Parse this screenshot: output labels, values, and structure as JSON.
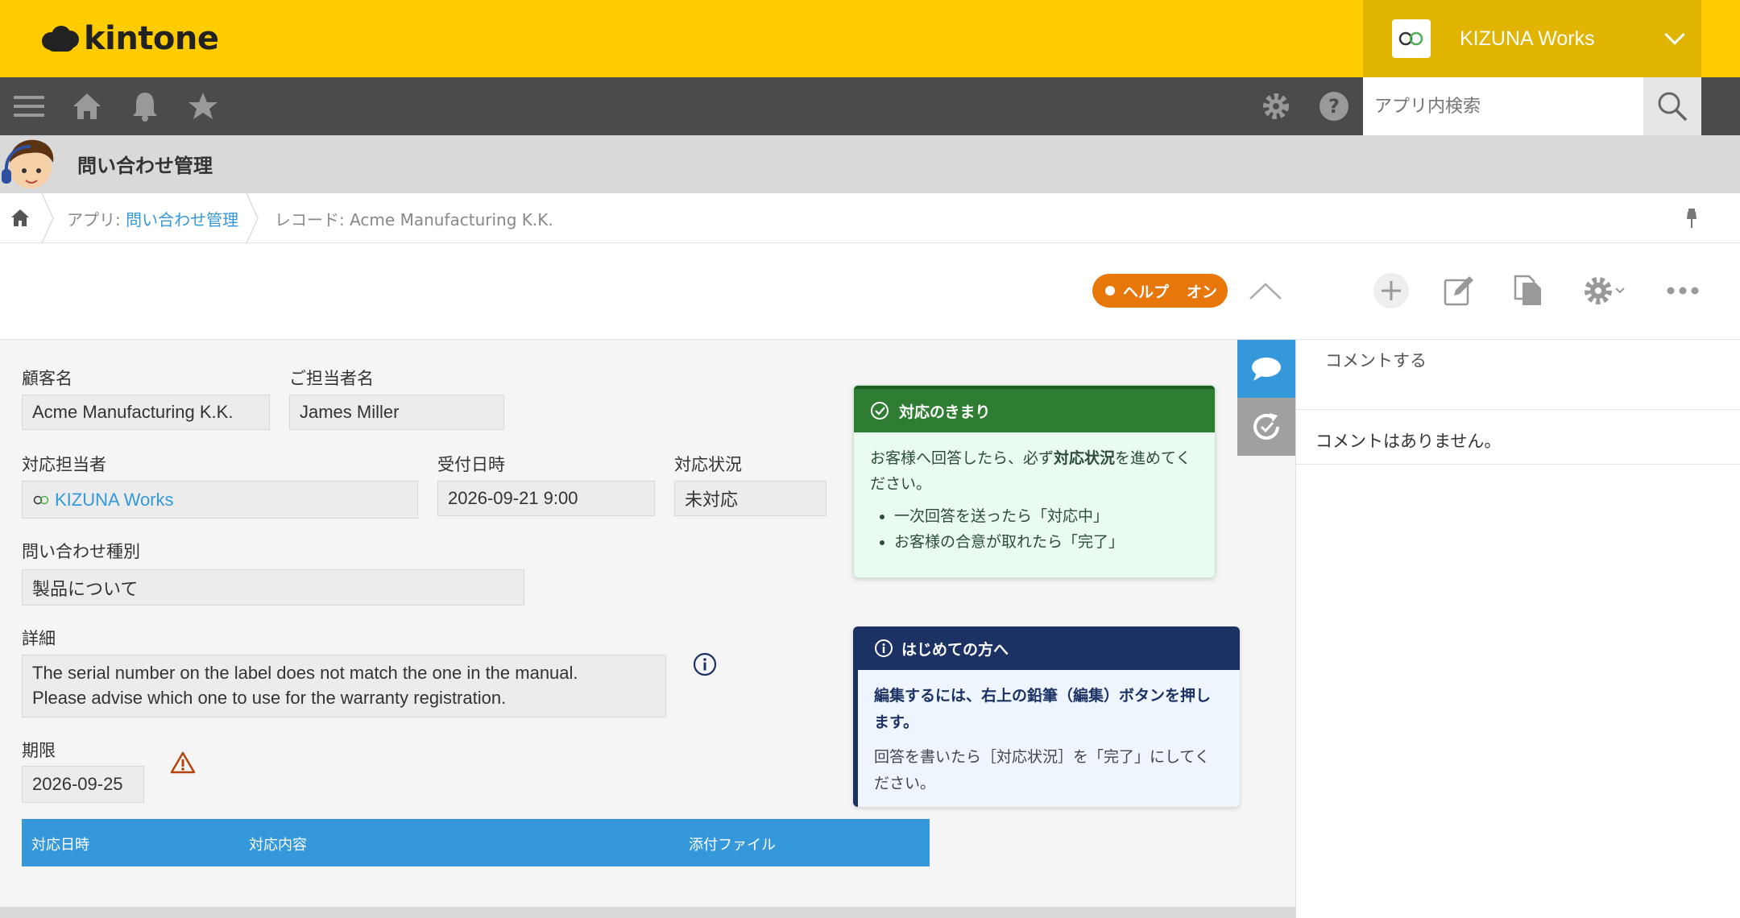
{
  "header": {
    "logo_text": "kintone",
    "org_name": "KIZUNA Works",
    "search_placeholder": "アプリ内検索"
  },
  "app": {
    "title": "問い合わせ管理"
  },
  "breadcrumb": {
    "app_prefix": "アプリ: ",
    "app_link": "問い合わせ管理",
    "record": "レコード: Acme Manufacturing K.K."
  },
  "toolbar": {
    "help_label": "ヘルプ",
    "help_state": "オン"
  },
  "fields": {
    "customer": {
      "label": "顧客名",
      "value": "Acme Manufacturing K.K."
    },
    "contact": {
      "label": "ご担当者名",
      "value": "James Miller"
    },
    "assignee": {
      "label": "対応担当者",
      "value": "KIZUNA Works"
    },
    "received": {
      "label": "受付日時",
      "value": "2026-09-21 9:00"
    },
    "status": {
      "label": "対応状況",
      "value": "未対応"
    },
    "category": {
      "label": "問い合わせ種別",
      "value": "製品について"
    },
    "detail": {
      "label": "詳細",
      "line1": "The serial number on the label does not match the one in the manual.",
      "line2": "Please advise which one to use for the warranty registration."
    },
    "deadline": {
      "label": "期限",
      "value": "2026-09-25"
    }
  },
  "table": {
    "columns": [
      "対応日時",
      "対応内容",
      "添付ファイル"
    ]
  },
  "notice_rules": {
    "title": "対応のきまり",
    "body_pre": "お客様へ回答したら、必ず",
    "body_bold": "対応状況",
    "body_post": "を進めてください。",
    "items": [
      "一次回答を送ったら「対応中」",
      "お客様の合意が取れたら「完了」"
    ]
  },
  "notice_first": {
    "title": "はじめての方へ",
    "bold": "編集するには、右上の鉛筆（編集）ボタンを押します。",
    "sub": "回答を書いたら［対応状況］を「完了」にしてください。"
  },
  "comments": {
    "input_placeholder": "コメントする",
    "empty": "コメントはありません。"
  },
  "colors": {
    "topbar": "#ffcc00",
    "navbar": "#4b4b4b",
    "accent": "#3498db",
    "help": "#e8770b",
    "green_header": "#2e7d32",
    "navy_header": "#1c3264"
  }
}
